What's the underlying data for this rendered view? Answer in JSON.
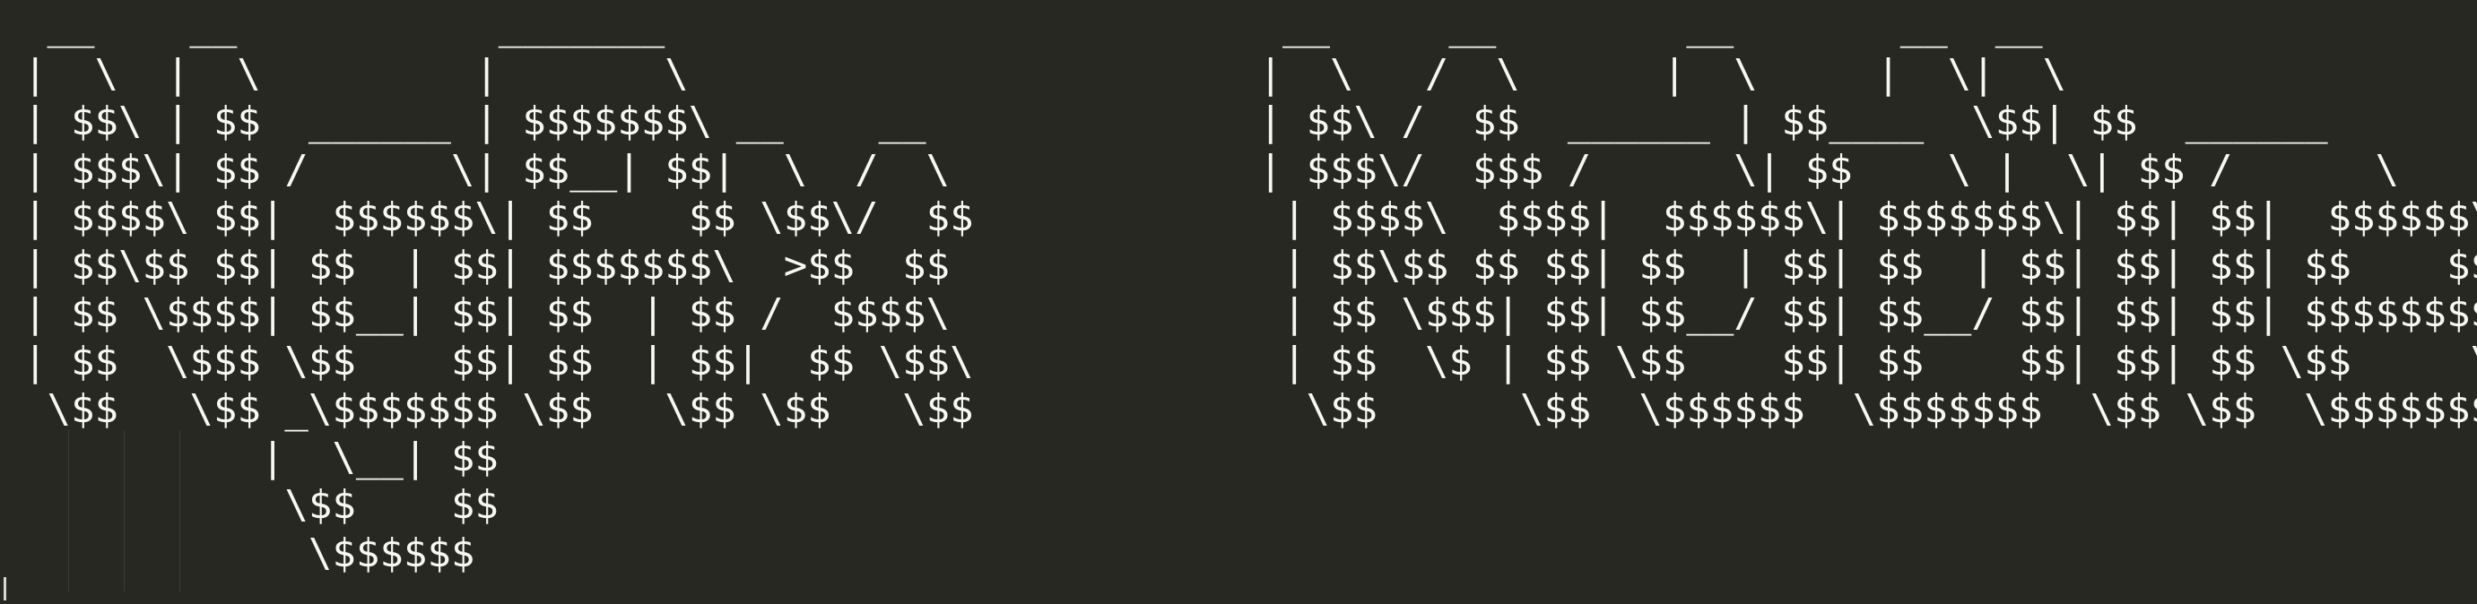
{
  "terminal": {
    "background": "#272822",
    "foreground": "#f8f8f2",
    "banner_lines": [
      " __    __           _______                          __     __        __       __  __",
      "|  \\  |  \\         |       \\                        |  \\   /  \\      |  \\     |  \\|  \\",
      "| $$\\ | $$  ______ | $$$$$$$\\ __    __              | $$\\ /  $$  ______ | $$____  \\$$| $$  ______",
      "| $$$\\| $$ /      \\| $$__| $$|  \\  /  \\             | $$$\\/  $$$ /      \\| $$    \\ |  \\| $$ /      \\",
      "| $$$$\\ $$|  $$$$$$\\| $$    $$ \\$$\\/  $$             | $$$$\\  $$$$|  $$$$$$\\| $$$$$$$\\| $$| $$|  $$$$$$\\",
      "| $$\\$$ $$| $$  | $$| $$$$$$$\\  >$$  $$              | $$\\$$ $$ $$| $$  | $$| $$  | $$| $$| $$| $$    $$",
      "| $$ \\$$$$| $$__| $$| $$  | $$ /  $$$$\\              | $$ \\$$$| $$| $$__/ $$| $$__/ $$| $$| $$| $$$$$$$$",
      "| $$  \\$$$ \\$$    $$| $$  | $$|  $$ \\$$\\             | $$  \\$ | $$ \\$$    $$| $$    $$| $$| $$ \\$$     \\",
      " \\$$   \\$$ _\\$$$$$$$ \\$$   \\$$ \\$$   \\$$              \\$$      \\$$  \\$$$$$$  \\$$$$$$$  \\$$ \\$$  \\$$$$$$$",
      "          |  \\__| $$",
      "           \\$$    $$",
      "            \\$$$$$$"
    ]
  }
}
